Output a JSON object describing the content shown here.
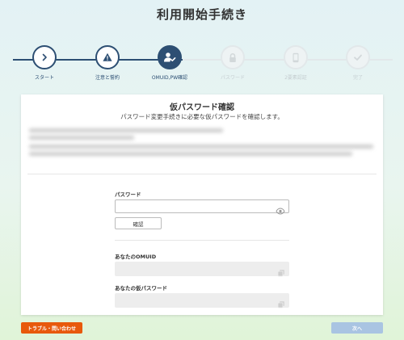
{
  "page": {
    "title": "利用開始手続き"
  },
  "stepper": {
    "steps": [
      {
        "label": "スタート",
        "icon": "chevron-right-icon",
        "state": "done"
      },
      {
        "label": "注意と誓約",
        "icon": "warning-icon",
        "state": "done"
      },
      {
        "label": "OMUID,PW確認",
        "icon": "user-check-icon",
        "state": "active"
      },
      {
        "label": "パスワード",
        "icon": "lock-icon",
        "state": "todo"
      },
      {
        "label": "2要素認証",
        "icon": "phone-icon",
        "state": "todo"
      },
      {
        "label": "完了",
        "icon": "check-icon",
        "state": "todo"
      }
    ]
  },
  "card": {
    "title": "仮パスワード確認",
    "subtitle": "パスワード変更手続きに必要な仮パスワードを確認します。",
    "password_label": "パスワード",
    "password_value": "",
    "confirm_label": "確認",
    "omuid_label": "あなたのOMUID",
    "omuid_value": "",
    "temp_password_label": "あなたの仮パスワード",
    "temp_password_value": ""
  },
  "footer": {
    "trouble_label": "トラブル・問い合わせ",
    "next_label": "次へ"
  },
  "colors": {
    "accent": "#2d4f73",
    "trouble": "#e8590c",
    "next_disabled": "#a9c4e2"
  }
}
